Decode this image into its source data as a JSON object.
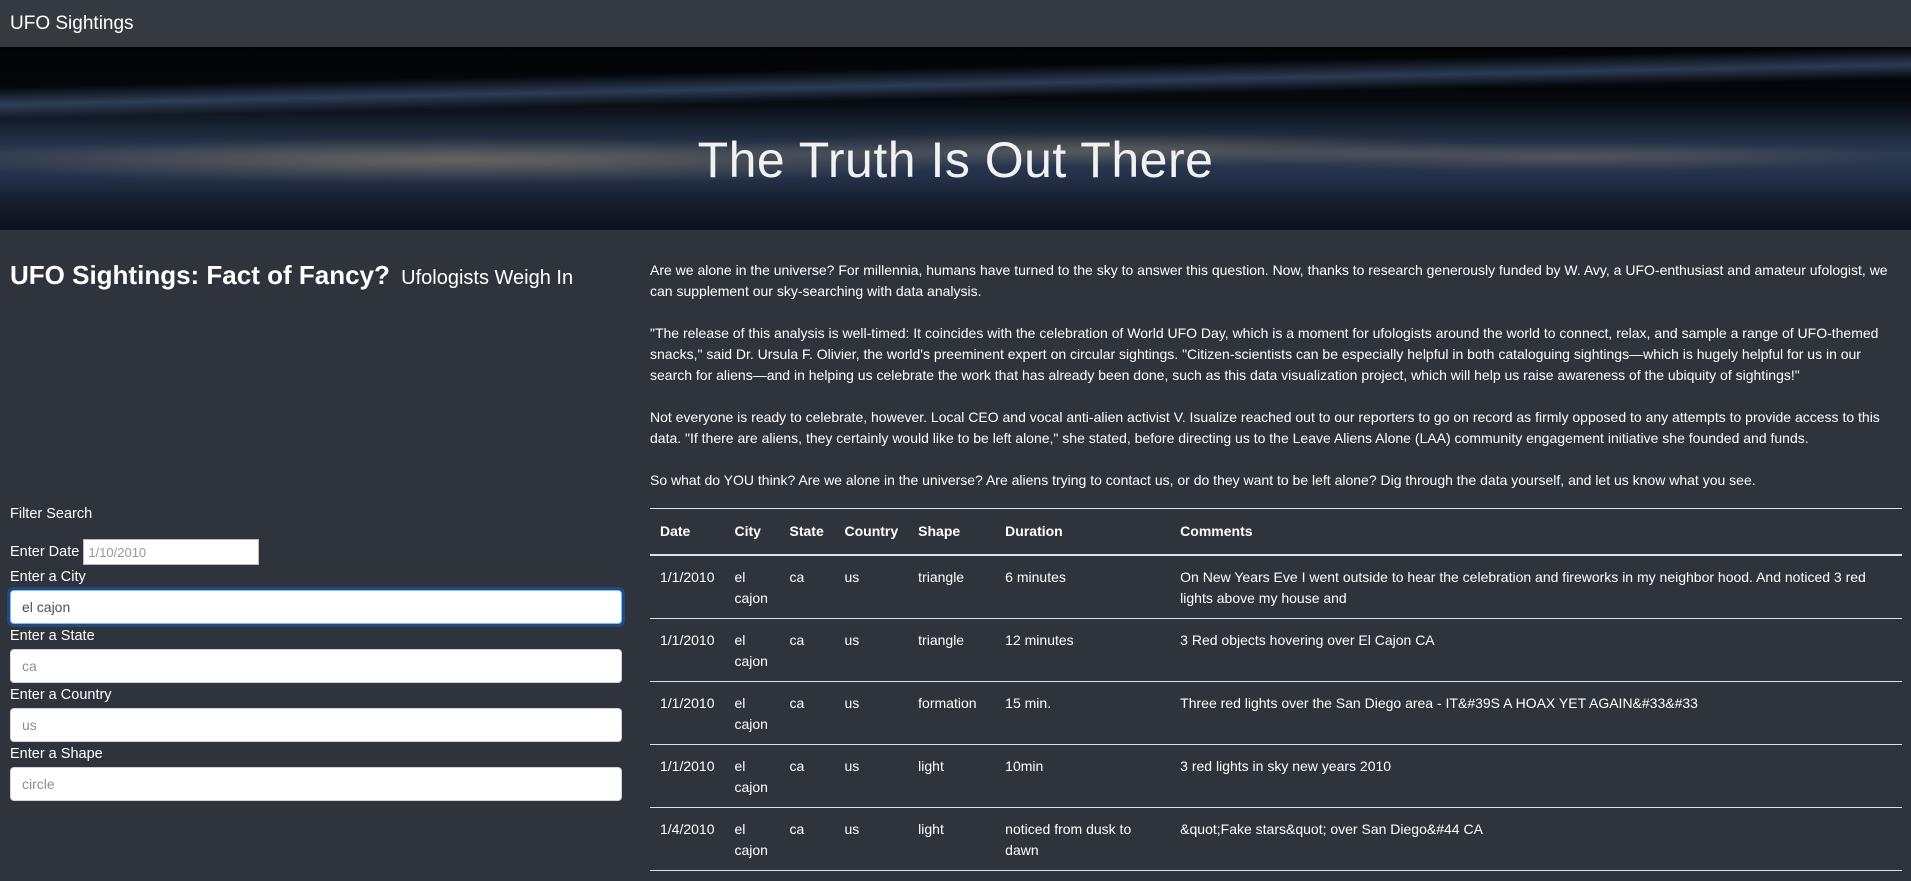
{
  "navbar": {
    "brand": "UFO Sightings"
  },
  "hero": {
    "title": "The Truth Is Out There"
  },
  "main": {
    "heading": "UFO Sightings: Fact of Fancy?",
    "subheading": "Ufologists Weigh In"
  },
  "filters": {
    "title": "Filter Search",
    "date": {
      "label": "Enter Date",
      "placeholder": "1/10/2010",
      "value": ""
    },
    "city": {
      "label": "Enter a City",
      "placeholder": "",
      "value": "el cajon"
    },
    "state": {
      "label": "Enter a State",
      "placeholder": "ca",
      "value": ""
    },
    "country": {
      "label": "Enter a Country",
      "placeholder": "us",
      "value": ""
    },
    "shape": {
      "label": "Enter a Shape",
      "placeholder": "circle",
      "value": ""
    }
  },
  "article": {
    "paragraphs": [
      "Are we alone in the universe? For millennia, humans have turned to the sky to answer this question. Now, thanks to research generously funded by W. Avy, a UFO-enthusiast and amateur ufologist, we can supplement our sky-searching with data analysis.",
      "\"The release of this analysis is well-timed: It coincides with the celebration of World UFO Day, which is a moment for ufologists around the world to connect, relax, and sample a range of UFO-themed snacks,\" said Dr. Ursula F. Olivier, the world's preeminent expert on circular sightings. \"Citizen-scientists can be especially helpful in both cataloguing sightings—which is hugely helpful for us in our search for aliens—and in helping us celebrate the work that has already been done, such as this data visualization project, which will help us raise awareness of the ubiquity of sightings!\"",
      "Not everyone is ready to celebrate, however. Local CEO and vocal anti-alien activist V. Isualize reached out to our reporters to go on record as firmly opposed to any attempts to provide access to this data. \"If there are aliens, they certainly would like to be left alone,\" she stated, before directing us to the Leave Aliens Alone (LAA) community engagement initiative she founded and funds.",
      "So what do YOU think? Are we alone in the universe? Are aliens trying to contact us, or do they want to be left alone? Dig through the data yourself, and let us know what you see."
    ]
  },
  "table": {
    "headers": [
      "Date",
      "City",
      "State",
      "Country",
      "Shape",
      "Duration",
      "Comments"
    ],
    "rows": [
      [
        "1/1/2010",
        "el cajon",
        "ca",
        "us",
        "triangle",
        "6 minutes",
        "On New Years Eve I went outside to hear the celebration and fireworks in my neighbor hood. And noticed 3 red lights above my house and"
      ],
      [
        "1/1/2010",
        "el cajon",
        "ca",
        "us",
        "triangle",
        "12 minutes",
        "3 Red objects hovering over El Cajon CA"
      ],
      [
        "1/1/2010",
        "el cajon",
        "ca",
        "us",
        "formation",
        "15 min.",
        "Three red lights over the San Diego area - IT&#39S A HOAX YET AGAIN&#33&#33"
      ],
      [
        "1/1/2010",
        "el cajon",
        "ca",
        "us",
        "light",
        "10min",
        "3 red lights in sky new years 2010"
      ],
      [
        "1/4/2010",
        "el cajon",
        "ca",
        "us",
        "light",
        "noticed from dusk to dawn",
        "&quot;Fake stars&quot; over San Diego&#44 CA"
      ]
    ]
  }
}
